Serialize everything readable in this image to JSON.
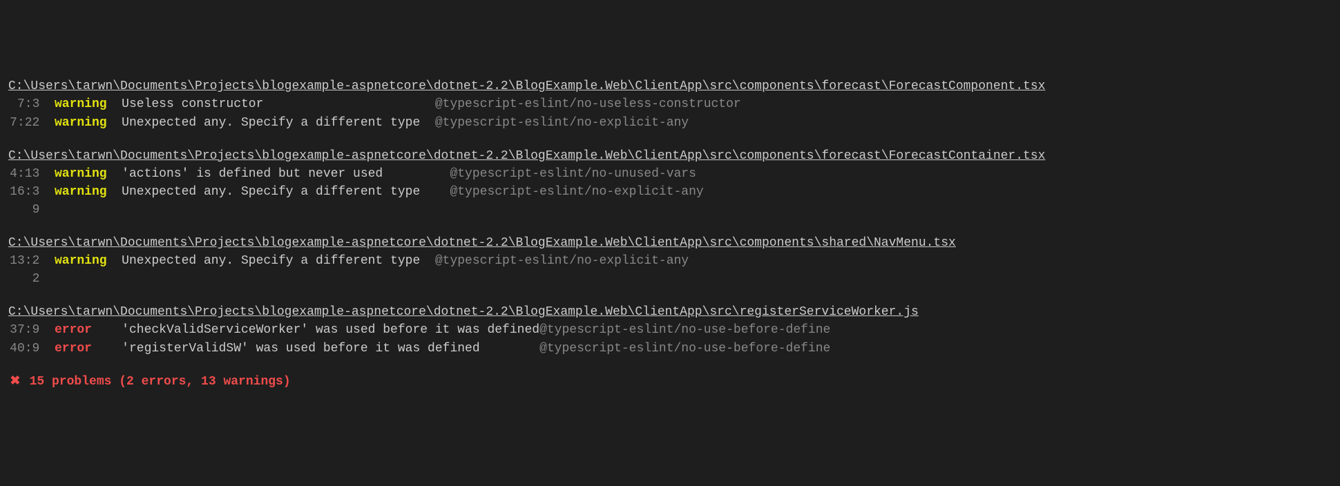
{
  "files": [
    {
      "path": "C:\\Users\\tarwn\\Documents\\Projects\\blogexample-aspnetcore\\dotnet-2.2\\BlogExample.Web\\ClientApp\\src\\components\\forecast\\ForecastComponent.tsx",
      "msg_width_ch": 42,
      "issues": [
        {
          "location": "7:3",
          "severity": "warning",
          "message": "Useless constructor",
          "rule": "@typescript-eslint/no-useless-constructor"
        },
        {
          "location": "7:22",
          "severity": "warning",
          "message": "Unexpected any. Specify a different type",
          "rule": "@typescript-eslint/no-explicit-any"
        }
      ]
    },
    {
      "path": "C:\\Users\\tarwn\\Documents\\Projects\\blogexample-aspnetcore\\dotnet-2.2\\BlogExample.Web\\ClientApp\\src\\components\\forecast\\ForecastContainer.tsx",
      "msg_width_ch": 44,
      "issues": [
        {
          "location": "4:13",
          "severity": "warning",
          "message": "'actions' is defined but never used",
          "rule": "@typescript-eslint/no-unused-vars"
        },
        {
          "location": "16:39",
          "severity": "warning",
          "message": "Unexpected any. Specify a different type",
          "rule": "@typescript-eslint/no-explicit-any"
        }
      ]
    },
    {
      "path": "C:\\Users\\tarwn\\Documents\\Projects\\blogexample-aspnetcore\\dotnet-2.2\\BlogExample.Web\\ClientApp\\src\\components\\shared\\NavMenu.tsx",
      "msg_width_ch": 42,
      "issues": [
        {
          "location": "13:22",
          "severity": "warning",
          "message": "Unexpected any. Specify a different type",
          "rule": "@typescript-eslint/no-explicit-any"
        }
      ]
    },
    {
      "path": "C:\\Users\\tarwn\\Documents\\Projects\\blogexample-aspnetcore\\dotnet-2.2\\BlogExample.Web\\ClientApp\\src\\registerServiceWorker.js",
      "msg_width_ch": 56,
      "issues": [
        {
          "location": "37:9",
          "severity": "error",
          "message": "'checkValidServiceWorker' was used before it was defined",
          "rule": "@typescript-eslint/no-use-before-define"
        },
        {
          "location": "40:9",
          "severity": "error",
          "message": "'registerValidSW' was used before it was defined",
          "rule": "@typescript-eslint/no-use-before-define"
        }
      ]
    }
  ],
  "summary": {
    "icon": "✖",
    "text": "15 problems (2 errors, 13 warnings)"
  }
}
